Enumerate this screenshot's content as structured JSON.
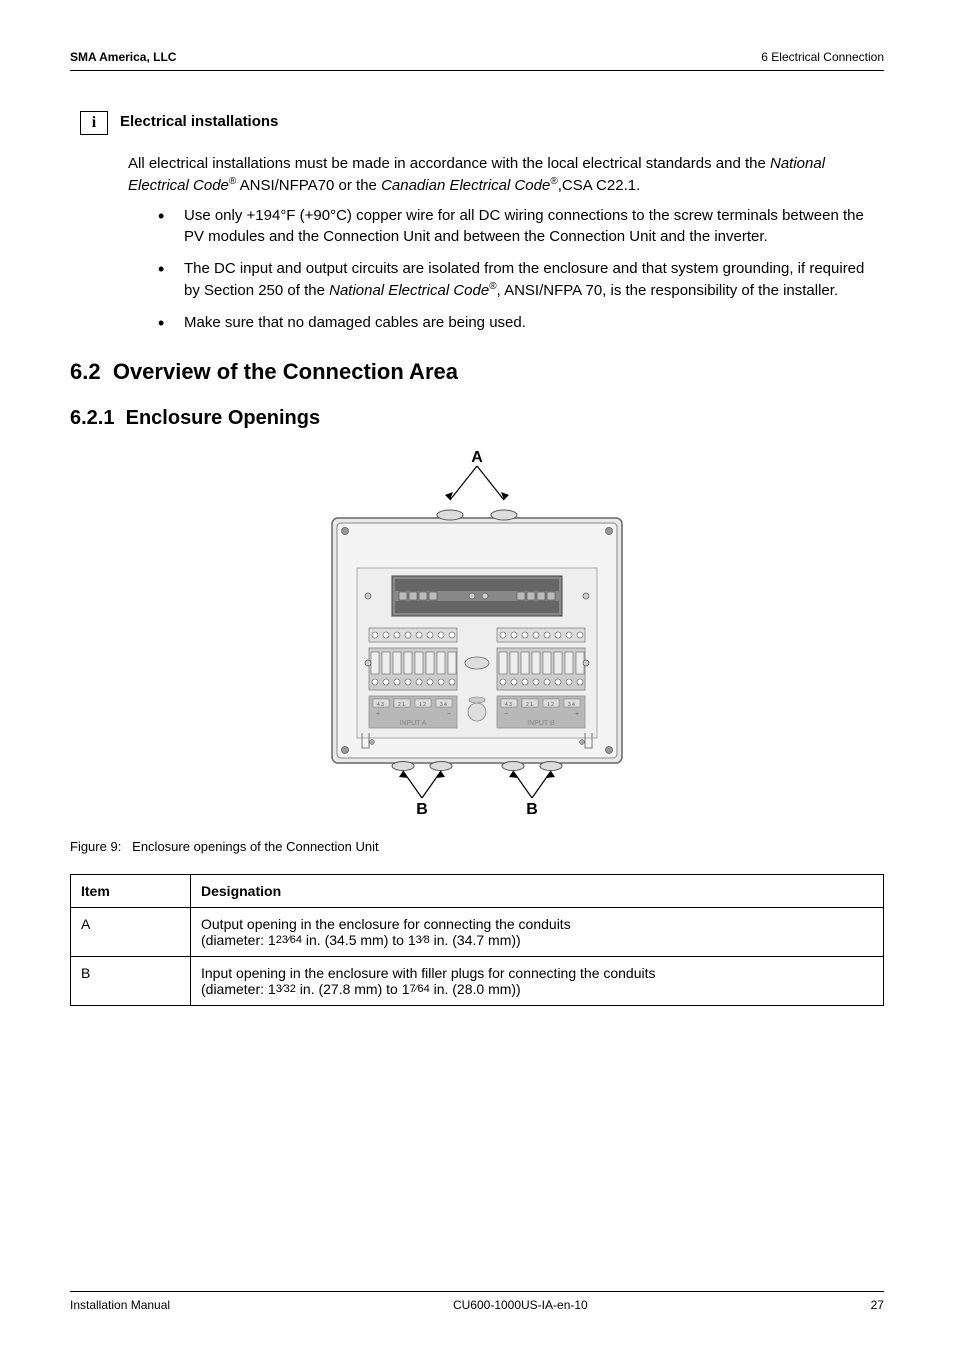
{
  "header": {
    "left": "SMA America, LLC",
    "right": "6  Electrical Connection"
  },
  "info": {
    "icon_glyph": "i",
    "title": "Electrical installations",
    "intro_prefix": "All electrical installations must be made in accordance with the local electrical standards and the ",
    "nec_label": "National Electrical Code",
    "reg_symbol": "®",
    "ansi_text": " ANSI/NFPA70 or the ",
    "cec_label": "Canadian Electrical Code",
    "csa_text": "CSA C22.1.",
    "bullets": [
      "Use only +194°F (+90°C) copper wire for all DC wiring connections to the screw terminals between the PV modules and the Connection Unit and between the Connection Unit and the inverter.",
      "",
      "Make sure that no damaged cables are being used."
    ],
    "bullet2_pre": "The DC input and output circuits are isolated from the enclosure and that system grounding, if required by Section 250 of the ",
    "bullet2_mid": ", ANSI/NFPA 70, is the responsibility of the installer."
  },
  "section": {
    "num": "6.2",
    "title": "Overview of the Connection Area"
  },
  "subsection": {
    "num": "6.2.1",
    "title": "Enclosure Openings"
  },
  "figure": {
    "label_a": "A",
    "label_b": "B",
    "input_a": "INPUT A",
    "input_b": "INPUT B",
    "caption_prefix": "Figure 9:",
    "caption_text": "Enclosure openings of the Connection Unit"
  },
  "table": {
    "headers": [
      "Item",
      "Designation"
    ],
    "rows": [
      {
        "item": "A",
        "desc_line1": "Output opening in the enclosure for connecting the conduits",
        "desc_line2_pre": "(diameter:  1",
        "desc_frac1": "23⁄64",
        "desc_mid1": " in. (34.5 mm) to 1",
        "desc_frac2": "3⁄8",
        "desc_end": " in. (34.7 mm))"
      },
      {
        "item": "B",
        "desc_line1": "Input opening in the enclosure with filler plugs for connecting the conduits",
        "desc_line2_pre": "(diameter: 1",
        "desc_frac1": "3⁄32",
        "desc_mid1": " in. (27.8 mm) to 1",
        "desc_frac2": "7⁄64",
        "desc_end": " in. (28.0 mm))"
      }
    ]
  },
  "footer": {
    "left": "Installation Manual",
    "center": "CU600-1000US-IA-en-10",
    "right": "27"
  }
}
